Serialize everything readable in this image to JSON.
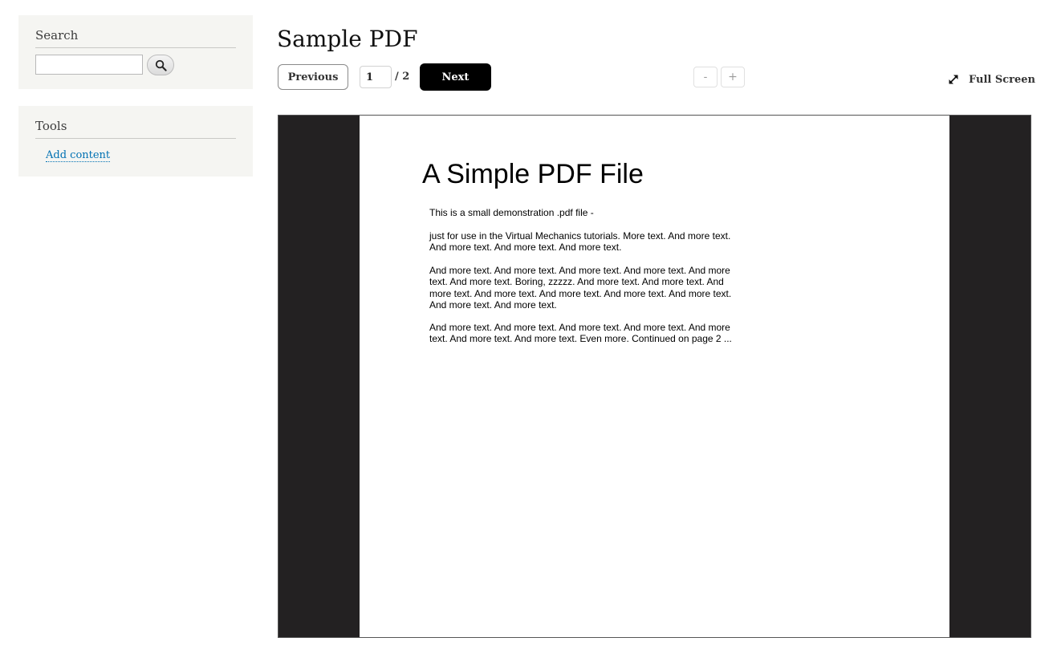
{
  "sidebar": {
    "search": {
      "title": "Search",
      "input_value": "",
      "button_icon": "search-icon"
    },
    "tools": {
      "title": "Tools",
      "links": [
        {
          "label": "Add content"
        }
      ]
    }
  },
  "main": {
    "title": "Sample PDF",
    "toolbar": {
      "previous_label": "Previous",
      "current_page": "1",
      "total_pages": "/ 2",
      "next_label": "Next",
      "zoom_out_label": "-",
      "zoom_in_label": "+",
      "fullscreen_label": "Full Screen",
      "fullscreen_icon": "expand-icon"
    },
    "pdf": {
      "heading": "A Simple PDF File",
      "paragraphs": [
        "This is a small demonstration .pdf file -",
        "just for use in the Virtual Mechanics tutorials. More text. And more text. And more text. And more text. And more text.",
        "And more text. And more text. And more text. And more text. And more text. And more text. Boring, zzzzz. And more text. And more text. And more text. And more text. And more text. And more text. And more text. And more text. And more text.",
        "And more text. And more text. And more text. And more text. And more text. And more text. And more text. Even more. Continued on page 2 ..."
      ]
    }
  },
  "colors": {
    "sidebar_bg": "#f5f5f2",
    "link": "#0071b3",
    "next_button_bg": "#000000",
    "viewer_bg": "#232122"
  }
}
